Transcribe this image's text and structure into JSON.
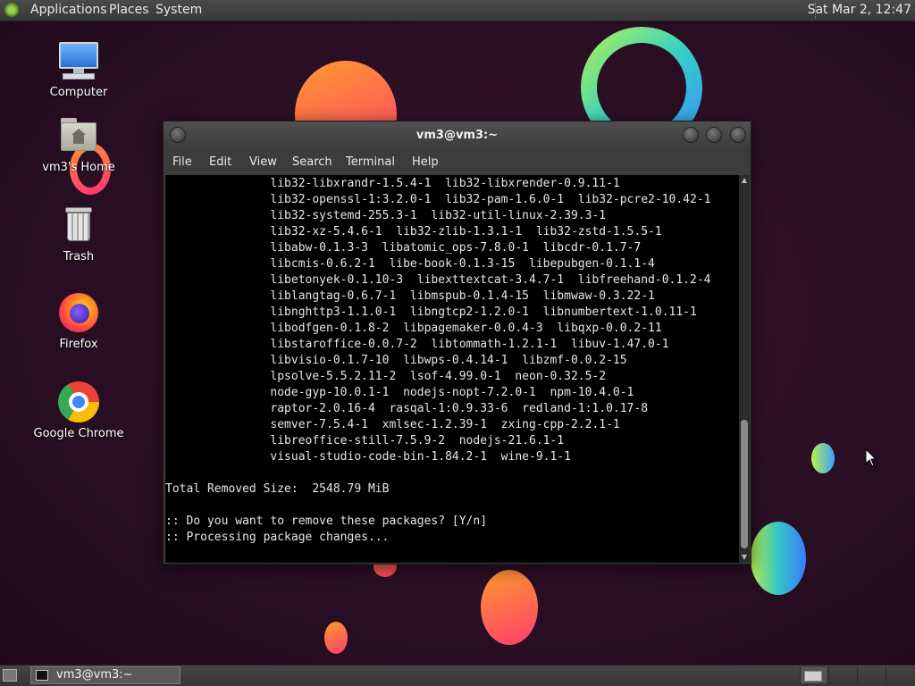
{
  "top_panel": {
    "menus": [
      "Applications",
      "Places",
      "System"
    ],
    "clock": "Sat Mar  2, 12:47"
  },
  "desktop_icons": [
    {
      "label": "Computer",
      "icon": "computer-icon"
    },
    {
      "label": "vm3's Home",
      "icon": "home-folder-icon"
    },
    {
      "label": "Trash",
      "icon": "trash-icon"
    },
    {
      "label": "Firefox",
      "icon": "firefox-icon"
    },
    {
      "label": "Google Chrome",
      "icon": "chrome-icon"
    }
  ],
  "terminal": {
    "title": "vm3@vm3:~",
    "menus": [
      "File",
      "Edit",
      "View",
      "Search",
      "Terminal",
      "Help"
    ],
    "lines": [
      "               lib32-libxrandr-1.5.4-1  lib32-libxrender-0.9.11-1",
      "               lib32-openssl-1:3.2.0-1  lib32-pam-1.6.0-1  lib32-pcre2-10.42-1",
      "               lib32-systemd-255.3-1  lib32-util-linux-2.39.3-1",
      "               lib32-xz-5.4.6-1  lib32-zlib-1.3.1-1  lib32-zstd-1.5.5-1",
      "               libabw-0.1.3-3  libatomic_ops-7.8.0-1  libcdr-0.1.7-7",
      "               libcmis-0.6.2-1  libe-book-0.1.3-15  libepubgen-0.1.1-4",
      "               libetonyek-0.1.10-3  libexttextcat-3.4.7-1  libfreehand-0.1.2-4",
      "               liblangtag-0.6.7-1  libmspub-0.1.4-15  libmwaw-0.3.22-1",
      "               libnghttp3-1.1.0-1  libngtcp2-1.2.0-1  libnumbertext-1.0.11-1",
      "               libodfgen-0.1.8-2  libpagemaker-0.0.4-3  libqxp-0.0.2-11",
      "               libstaroffice-0.0.7-2  libtommath-1.2.1-1  libuv-1.47.0-1",
      "               libvisio-0.1.7-10  libwps-0.4.14-1  libzmf-0.0.2-15",
      "               lpsolve-5.5.2.11-2  lsof-4.99.0-1  neon-0.32.5-2",
      "               node-gyp-10.0.1-1  nodejs-nopt-7.2.0-1  npm-10.4.0-1",
      "               raptor-2.0.16-4  rasqal-1:0.9.33-6  redland-1:1.0.17-8",
      "               semver-7.5.4-1  xmlsec-1.2.39-1  zxing-cpp-2.2.1-1",
      "               libreoffice-still-7.5.9-2  nodejs-21.6.1-1",
      "               visual-studio-code-bin-1.84.2-1  wine-9.1-1",
      "",
      "Total Removed Size:  2548.79 MiB",
      "",
      ":: Do you want to remove these packages? [Y/n]",
      ":: Processing package changes..."
    ]
  },
  "taskbar": {
    "task_label": "vm3@vm3:~"
  }
}
